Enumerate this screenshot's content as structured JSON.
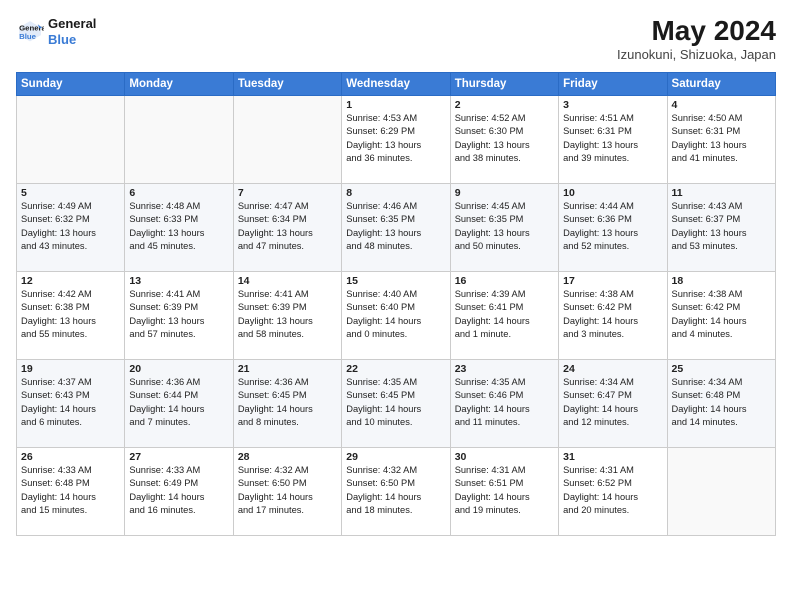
{
  "header": {
    "logo_line1": "General",
    "logo_line2": "Blue",
    "title": "May 2024",
    "subtitle": "Izunokuni, Shizuoka, Japan"
  },
  "days_of_week": [
    "Sunday",
    "Monday",
    "Tuesday",
    "Wednesday",
    "Thursday",
    "Friday",
    "Saturday"
  ],
  "weeks": [
    [
      {
        "day": "",
        "info": ""
      },
      {
        "day": "",
        "info": ""
      },
      {
        "day": "",
        "info": ""
      },
      {
        "day": "1",
        "info": "Sunrise: 4:53 AM\nSunset: 6:29 PM\nDaylight: 13 hours\nand 36 minutes."
      },
      {
        "day": "2",
        "info": "Sunrise: 4:52 AM\nSunset: 6:30 PM\nDaylight: 13 hours\nand 38 minutes."
      },
      {
        "day": "3",
        "info": "Sunrise: 4:51 AM\nSunset: 6:31 PM\nDaylight: 13 hours\nand 39 minutes."
      },
      {
        "day": "4",
        "info": "Sunrise: 4:50 AM\nSunset: 6:31 PM\nDaylight: 13 hours\nand 41 minutes."
      }
    ],
    [
      {
        "day": "5",
        "info": "Sunrise: 4:49 AM\nSunset: 6:32 PM\nDaylight: 13 hours\nand 43 minutes."
      },
      {
        "day": "6",
        "info": "Sunrise: 4:48 AM\nSunset: 6:33 PM\nDaylight: 13 hours\nand 45 minutes."
      },
      {
        "day": "7",
        "info": "Sunrise: 4:47 AM\nSunset: 6:34 PM\nDaylight: 13 hours\nand 47 minutes."
      },
      {
        "day": "8",
        "info": "Sunrise: 4:46 AM\nSunset: 6:35 PM\nDaylight: 13 hours\nand 48 minutes."
      },
      {
        "day": "9",
        "info": "Sunrise: 4:45 AM\nSunset: 6:35 PM\nDaylight: 13 hours\nand 50 minutes."
      },
      {
        "day": "10",
        "info": "Sunrise: 4:44 AM\nSunset: 6:36 PM\nDaylight: 13 hours\nand 52 minutes."
      },
      {
        "day": "11",
        "info": "Sunrise: 4:43 AM\nSunset: 6:37 PM\nDaylight: 13 hours\nand 53 minutes."
      }
    ],
    [
      {
        "day": "12",
        "info": "Sunrise: 4:42 AM\nSunset: 6:38 PM\nDaylight: 13 hours\nand 55 minutes."
      },
      {
        "day": "13",
        "info": "Sunrise: 4:41 AM\nSunset: 6:39 PM\nDaylight: 13 hours\nand 57 minutes."
      },
      {
        "day": "14",
        "info": "Sunrise: 4:41 AM\nSunset: 6:39 PM\nDaylight: 13 hours\nand 58 minutes."
      },
      {
        "day": "15",
        "info": "Sunrise: 4:40 AM\nSunset: 6:40 PM\nDaylight: 14 hours\nand 0 minutes."
      },
      {
        "day": "16",
        "info": "Sunrise: 4:39 AM\nSunset: 6:41 PM\nDaylight: 14 hours\nand 1 minute."
      },
      {
        "day": "17",
        "info": "Sunrise: 4:38 AM\nSunset: 6:42 PM\nDaylight: 14 hours\nand 3 minutes."
      },
      {
        "day": "18",
        "info": "Sunrise: 4:38 AM\nSunset: 6:42 PM\nDaylight: 14 hours\nand 4 minutes."
      }
    ],
    [
      {
        "day": "19",
        "info": "Sunrise: 4:37 AM\nSunset: 6:43 PM\nDaylight: 14 hours\nand 6 minutes."
      },
      {
        "day": "20",
        "info": "Sunrise: 4:36 AM\nSunset: 6:44 PM\nDaylight: 14 hours\nand 7 minutes."
      },
      {
        "day": "21",
        "info": "Sunrise: 4:36 AM\nSunset: 6:45 PM\nDaylight: 14 hours\nand 8 minutes."
      },
      {
        "day": "22",
        "info": "Sunrise: 4:35 AM\nSunset: 6:45 PM\nDaylight: 14 hours\nand 10 minutes."
      },
      {
        "day": "23",
        "info": "Sunrise: 4:35 AM\nSunset: 6:46 PM\nDaylight: 14 hours\nand 11 minutes."
      },
      {
        "day": "24",
        "info": "Sunrise: 4:34 AM\nSunset: 6:47 PM\nDaylight: 14 hours\nand 12 minutes."
      },
      {
        "day": "25",
        "info": "Sunrise: 4:34 AM\nSunset: 6:48 PM\nDaylight: 14 hours\nand 14 minutes."
      }
    ],
    [
      {
        "day": "26",
        "info": "Sunrise: 4:33 AM\nSunset: 6:48 PM\nDaylight: 14 hours\nand 15 minutes."
      },
      {
        "day": "27",
        "info": "Sunrise: 4:33 AM\nSunset: 6:49 PM\nDaylight: 14 hours\nand 16 minutes."
      },
      {
        "day": "28",
        "info": "Sunrise: 4:32 AM\nSunset: 6:50 PM\nDaylight: 14 hours\nand 17 minutes."
      },
      {
        "day": "29",
        "info": "Sunrise: 4:32 AM\nSunset: 6:50 PM\nDaylight: 14 hours\nand 18 minutes."
      },
      {
        "day": "30",
        "info": "Sunrise: 4:31 AM\nSunset: 6:51 PM\nDaylight: 14 hours\nand 19 minutes."
      },
      {
        "day": "31",
        "info": "Sunrise: 4:31 AM\nSunset: 6:52 PM\nDaylight: 14 hours\nand 20 minutes."
      },
      {
        "day": "",
        "info": ""
      }
    ]
  ]
}
